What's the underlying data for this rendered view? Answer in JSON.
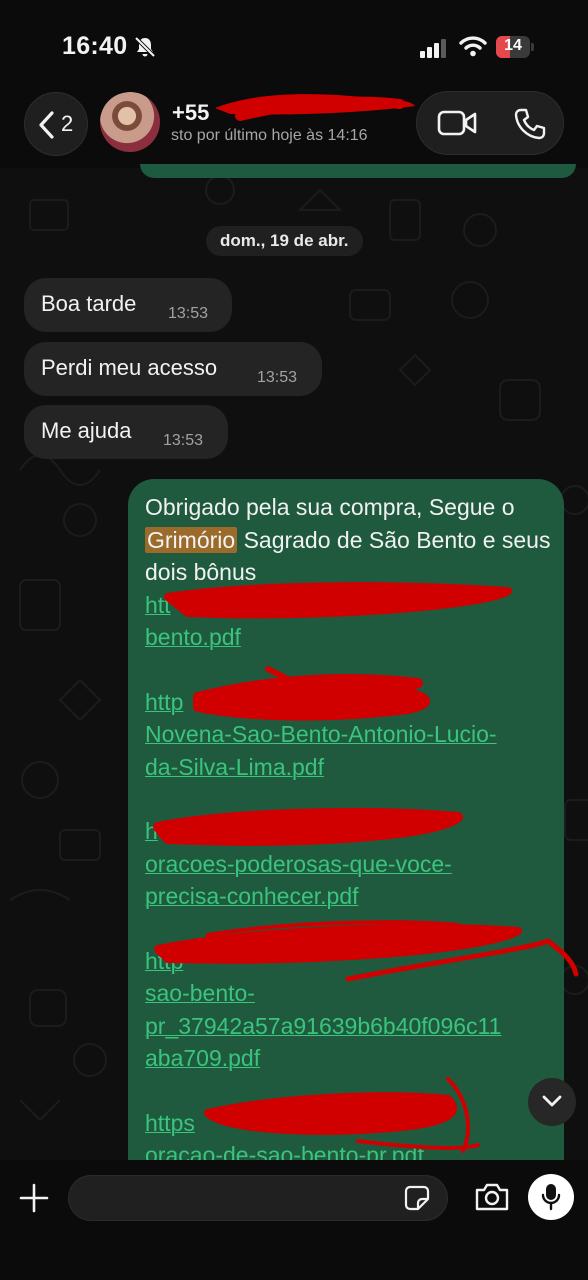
{
  "status_bar": {
    "time": "16:40",
    "battery": "14"
  },
  "header": {
    "back_count": "2",
    "contact_name": "+55",
    "contact_status": "sto por último hoje às 14:16"
  },
  "chat": {
    "date_separator": "dom., 19 de abr.",
    "incoming": [
      {
        "text": "Boa tarde",
        "time": "13:53"
      },
      {
        "text": "Perdi meu acesso",
        "time": "13:53"
      },
      {
        "text": "Me ajuda",
        "time": "13:53"
      }
    ],
    "outgoing": {
      "text_before": "Obrigado pela sua compra, Segue o",
      "highlight": "Grimório",
      "text_after": "Sagrado de São Bento e seus dois bônus",
      "links": [
        [
          "htt",
          "bento.pdf"
        ],
        [
          "http",
          "Novena-Sao-Bento-Antonio-Lucio-",
          "da-Silva-Lima.pdf"
        ],
        [
          "h",
          "oracoes-poderosas-que-voce-",
          "precisa-conhecer.pdf"
        ],
        [
          "http",
          "sao-bento-",
          "pr_37942a57a91639b6b40f096c11",
          "aba709.pdf"
        ],
        [
          "https",
          "oracao-de-sao-bento-pr.pdf"
        ]
      ]
    }
  },
  "colors": {
    "outgoing_bubble": "#1f5a3f",
    "incoming_bubble": "#232423",
    "link": "#3ac47d",
    "highlight": "#9b6b2c",
    "redaction": "#d10000"
  }
}
